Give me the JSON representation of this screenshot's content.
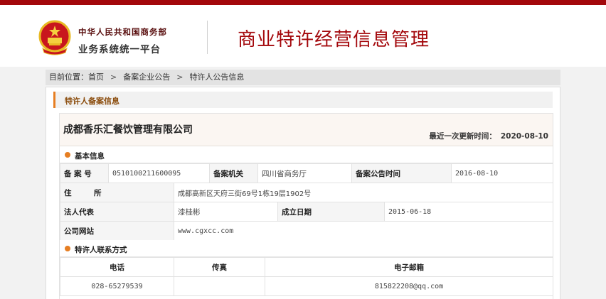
{
  "header": {
    "org_line1": "中华人民共和国商务部",
    "org_line2": "业务系统统一平台",
    "site_title": "商业特许经营信息管理"
  },
  "breadcrumb": {
    "prefix": "目前位置：",
    "items": [
      "首页",
      "备案企业公告",
      "特许人公告信息"
    ],
    "separator": ">"
  },
  "panel": {
    "title": "特许人备案信息",
    "company_name": "成都香乐汇餐饮管理有限公司",
    "updated_label": "最近一次更新时间：",
    "updated_value": "2020-08-10"
  },
  "basic_info": {
    "section_title": "基本信息",
    "record_no_label": "备 案 号",
    "record_no": "0510100211600095",
    "authority_label": "备案机关",
    "authority": "四川省商务厅",
    "announce_label": "备案公告时间",
    "announce_date": "2016-08-10",
    "address_label": "住　　　所",
    "address": "成都高新区天府三街69号1栋19层1902号",
    "legal_rep_label": "法人代表",
    "legal_rep": "漆桂彬",
    "founded_label": "成立日期",
    "founded": "2015-06-18",
    "website_label": "公司网站",
    "website": "www.cgxcc.com"
  },
  "contact": {
    "section_title": "特许人联系方式",
    "columns": [
      "电话",
      "传真",
      "电子邮箱"
    ],
    "phone": "028-65279539",
    "fax": "",
    "email": "815822208@qq.com"
  },
  "colors": {
    "brand_red": "#a3070b",
    "accent_orange": "#e67e22"
  }
}
